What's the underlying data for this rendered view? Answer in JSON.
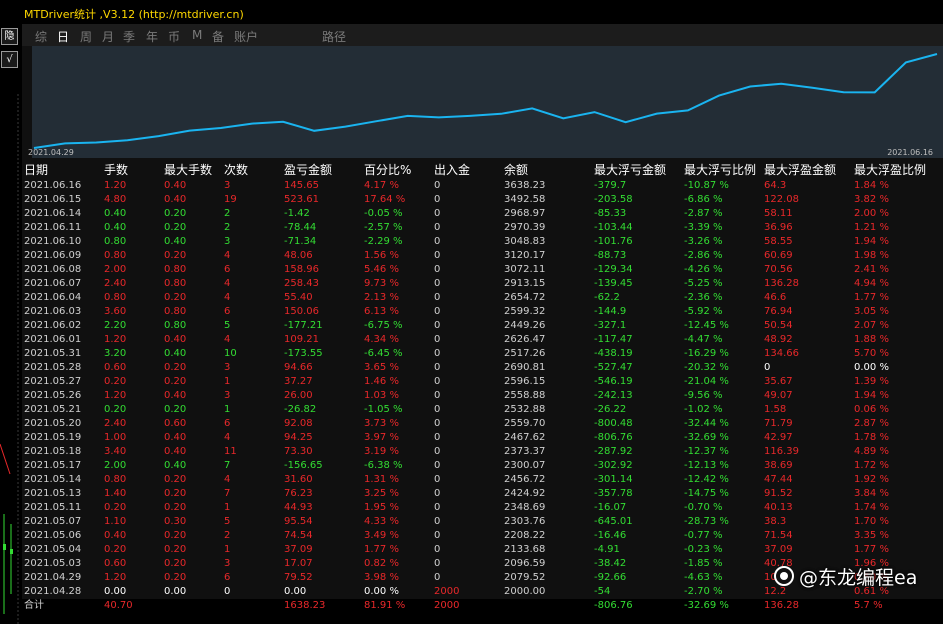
{
  "window": {
    "title": "MTDriver统计 ,V3.12 (http://mtdriver.cn)"
  },
  "side": {
    "btn1": "隐",
    "btn2": "√"
  },
  "tabs": [
    "综",
    "日",
    "周",
    "月",
    "季",
    "年",
    "币",
    "M",
    "备",
    "账户",
    "路径"
  ],
  "active_tab": "日",
  "chart": {
    "start_label": "2021.04.29",
    "end_label": "2021.06.16",
    "line_color": "#1ab4f0",
    "background": "#232d36"
  },
  "colors": {
    "red": "#e8282a",
    "green": "#33dd33",
    "accent": "#ffd800"
  },
  "table": {
    "headers": [
      "日期",
      "手数",
      "最大手数",
      "次数",
      "盈亏金额",
      "百分比%",
      "出入金",
      "余额",
      "最大浮亏金额",
      "最大浮亏比例",
      "最大浮盈金额",
      "最大浮盈比例"
    ],
    "rows": [
      [
        "2021.06.16",
        "1.20",
        "0.40",
        "3",
        "145.65",
        "4.17 %",
        "0",
        "3638.23",
        "-379.7",
        "-10.87 %",
        "64.3",
        "1.84 %"
      ],
      [
        "2021.06.15",
        "4.80",
        "0.40",
        "19",
        "523.61",
        "17.64 %",
        "0",
        "3492.58",
        "-203.58",
        "-6.86 %",
        "122.08",
        "3.82 %"
      ],
      [
        "2021.06.14",
        "0.40",
        "0.20",
        "2",
        "-1.42",
        "-0.05 %",
        "0",
        "2968.97",
        "-85.33",
        "-2.87 %",
        "58.11",
        "2.00 %"
      ],
      [
        "2021.06.11",
        "0.40",
        "0.20",
        "2",
        "-78.44",
        "-2.57 %",
        "0",
        "2970.39",
        "-103.44",
        "-3.39 %",
        "36.96",
        "1.21 %"
      ],
      [
        "2021.06.10",
        "0.80",
        "0.40",
        "3",
        "-71.34",
        "-2.29 %",
        "0",
        "3048.83",
        "-101.76",
        "-3.26 %",
        "58.55",
        "1.94 %"
      ],
      [
        "2021.06.09",
        "0.80",
        "0.20",
        "4",
        "48.06",
        "1.56 %",
        "0",
        "3120.17",
        "-88.73",
        "-2.86 %",
        "60.69",
        "1.98 %"
      ],
      [
        "2021.06.08",
        "2.00",
        "0.80",
        "6",
        "158.96",
        "5.46 %",
        "0",
        "3072.11",
        "-129.34",
        "-4.26 %",
        "70.56",
        "2.41 %"
      ],
      [
        "2021.06.07",
        "2.40",
        "0.80",
        "4",
        "258.43",
        "9.73 %",
        "0",
        "2913.15",
        "-139.45",
        "-5.25 %",
        "136.28",
        "4.94 %"
      ],
      [
        "2021.06.04",
        "0.80",
        "0.20",
        "4",
        "55.40",
        "2.13 %",
        "0",
        "2654.72",
        "-62.2",
        "-2.36 %",
        "46.6",
        "1.77 %"
      ],
      [
        "2021.06.03",
        "3.60",
        "0.80",
        "6",
        "150.06",
        "6.13 %",
        "0",
        "2599.32",
        "-144.9",
        "-5.92 %",
        "76.94",
        "3.05 %"
      ],
      [
        "2021.06.02",
        "2.20",
        "0.80",
        "5",
        "-177.21",
        "-6.75 %",
        "0",
        "2449.26",
        "-327.1",
        "-12.45 %",
        "50.54",
        "2.07 %"
      ],
      [
        "2021.06.01",
        "1.20",
        "0.40",
        "4",
        "109.21",
        "4.34 %",
        "0",
        "2626.47",
        "-117.47",
        "-4.47 %",
        "48.92",
        "1.88 %"
      ],
      [
        "2021.05.31",
        "3.20",
        "0.40",
        "10",
        "-173.55",
        "-6.45 %",
        "0",
        "2517.26",
        "-438.19",
        "-16.29 %",
        "134.66",
        "5.70 %"
      ],
      [
        "2021.05.28",
        "0.60",
        "0.20",
        "3",
        "94.66",
        "3.65 %",
        "0",
        "2690.81",
        "-527.47",
        "-20.32 %",
        "0",
        "0.00 %"
      ],
      [
        "2021.05.27",
        "0.20",
        "0.20",
        "1",
        "37.27",
        "1.46 %",
        "0",
        "2596.15",
        "-546.19",
        "-21.04 %",
        "35.67",
        "1.39 %"
      ],
      [
        "2021.05.26",
        "1.20",
        "0.40",
        "3",
        "26.00",
        "1.03 %",
        "0",
        "2558.88",
        "-242.13",
        "-9.56 %",
        "49.07",
        "1.94 %"
      ],
      [
        "2021.05.21",
        "0.20",
        "0.20",
        "1",
        "-26.82",
        "-1.05 %",
        "0",
        "2532.88",
        "-26.22",
        "-1.02 %",
        "1.58",
        "0.06 %"
      ],
      [
        "2021.05.20",
        "2.40",
        "0.60",
        "6",
        "92.08",
        "3.73 %",
        "0",
        "2559.70",
        "-800.48",
        "-32.44 %",
        "71.79",
        "2.87 %"
      ],
      [
        "2021.05.19",
        "1.00",
        "0.40",
        "4",
        "94.25",
        "3.97 %",
        "0",
        "2467.62",
        "-806.76",
        "-32.69 %",
        "42.97",
        "1.78 %"
      ],
      [
        "2021.05.18",
        "3.40",
        "0.40",
        "11",
        "73.30",
        "3.19 %",
        "0",
        "2373.37",
        "-287.92",
        "-12.37 %",
        "116.39",
        "4.89 %"
      ],
      [
        "2021.05.17",
        "2.00",
        "0.40",
        "7",
        "-156.65",
        "-6.38 %",
        "0",
        "2300.07",
        "-302.92",
        "-12.13 %",
        "38.69",
        "1.72 %"
      ],
      [
        "2021.05.14",
        "0.80",
        "0.20",
        "4",
        "31.60",
        "1.31 %",
        "0",
        "2456.72",
        "-301.14",
        "-12.42 %",
        "47.44",
        "1.92 %"
      ],
      [
        "2021.05.13",
        "1.40",
        "0.20",
        "7",
        "76.23",
        "3.25 %",
        "0",
        "2424.92",
        "-357.78",
        "-14.75 %",
        "91.52",
        "3.84 %"
      ],
      [
        "2021.05.11",
        "0.20",
        "0.20",
        "1",
        "44.93",
        "1.95 %",
        "0",
        "2348.69",
        "-16.07",
        "-0.70 %",
        "40.13",
        "1.74 %"
      ],
      [
        "2021.05.07",
        "1.10",
        "0.30",
        "5",
        "95.54",
        "4.33 %",
        "0",
        "2303.76",
        "-645.01",
        "-28.73 %",
        "38.3",
        "1.70 %"
      ],
      [
        "2021.05.06",
        "0.40",
        "0.20",
        "2",
        "74.54",
        "3.49 %",
        "0",
        "2208.22",
        "-16.46",
        "-0.77 %",
        "71.54",
        "3.35 %"
      ],
      [
        "2021.05.04",
        "0.20",
        "0.20",
        "1",
        "37.09",
        "1.77 %",
        "0",
        "2133.68",
        "-4.91",
        "-0.23 %",
        "37.09",
        "1.77 %"
      ],
      [
        "2021.05.03",
        "0.60",
        "0.20",
        "3",
        "17.07",
        "0.82 %",
        "0",
        "2096.59",
        "-38.42",
        "-1.85 %",
        "40.78",
        "1.96 %"
      ],
      [
        "2021.04.29",
        "1.20",
        "0.20",
        "6",
        "79.52",
        "3.98 %",
        "0",
        "2079.52",
        "-92.66",
        "-4.63 %",
        "10",
        "0.50 %"
      ],
      [
        "2021.04.28",
        "0.00",
        "0.00",
        "0",
        "0.00",
        "0.00 %",
        "2000",
        "2000.00",
        "-54",
        "-2.70 %",
        "12.2",
        "0.61 %"
      ]
    ],
    "total": [
      "合计",
      "40.70",
      "",
      "",
      "1638.23",
      "81.91 %",
      "2000",
      "",
      "-806.76",
      "-32.69 %",
      "136.28",
      "5.7 %"
    ]
  },
  "watermark": "@东龙编程ea"
}
